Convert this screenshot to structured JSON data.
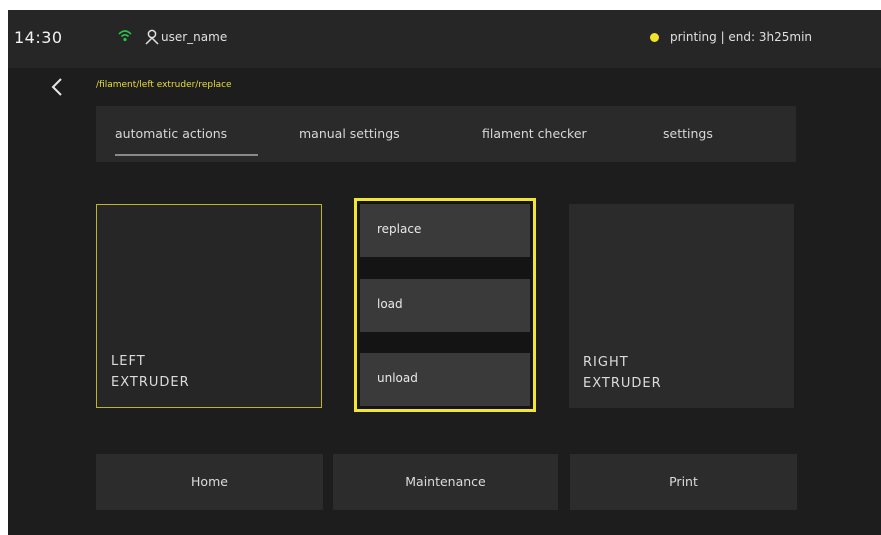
{
  "status": {
    "time": "14:30",
    "username": "user_name",
    "printer_status": "printing | end: 3h25min",
    "colors": {
      "wifi": "#29c24a",
      "status_dot": "#f2e22e",
      "accent": "#f3e533"
    }
  },
  "breadcrumb": "/filament/left extruder/replace",
  "tabs": [
    {
      "label": "automatic actions",
      "active": true
    },
    {
      "label": "manual settings"
    },
    {
      "label": "filament checker"
    },
    {
      "label": "settings"
    }
  ],
  "extruders": {
    "left": {
      "line1": "LEFT",
      "line2": "EXTRUDER",
      "selected": true
    },
    "right": {
      "line1": "RIGHT",
      "line2": "EXTRUDER"
    }
  },
  "actions": [
    {
      "label": "replace"
    },
    {
      "label": "load"
    },
    {
      "label": "unload"
    }
  ],
  "nav": [
    {
      "label": "Home"
    },
    {
      "label": "Maintenance"
    },
    {
      "label": "Print"
    }
  ],
  "icons": [
    "wifi-icon",
    "user-icon",
    "status-dot-icon",
    "back-chevron-icon"
  ]
}
